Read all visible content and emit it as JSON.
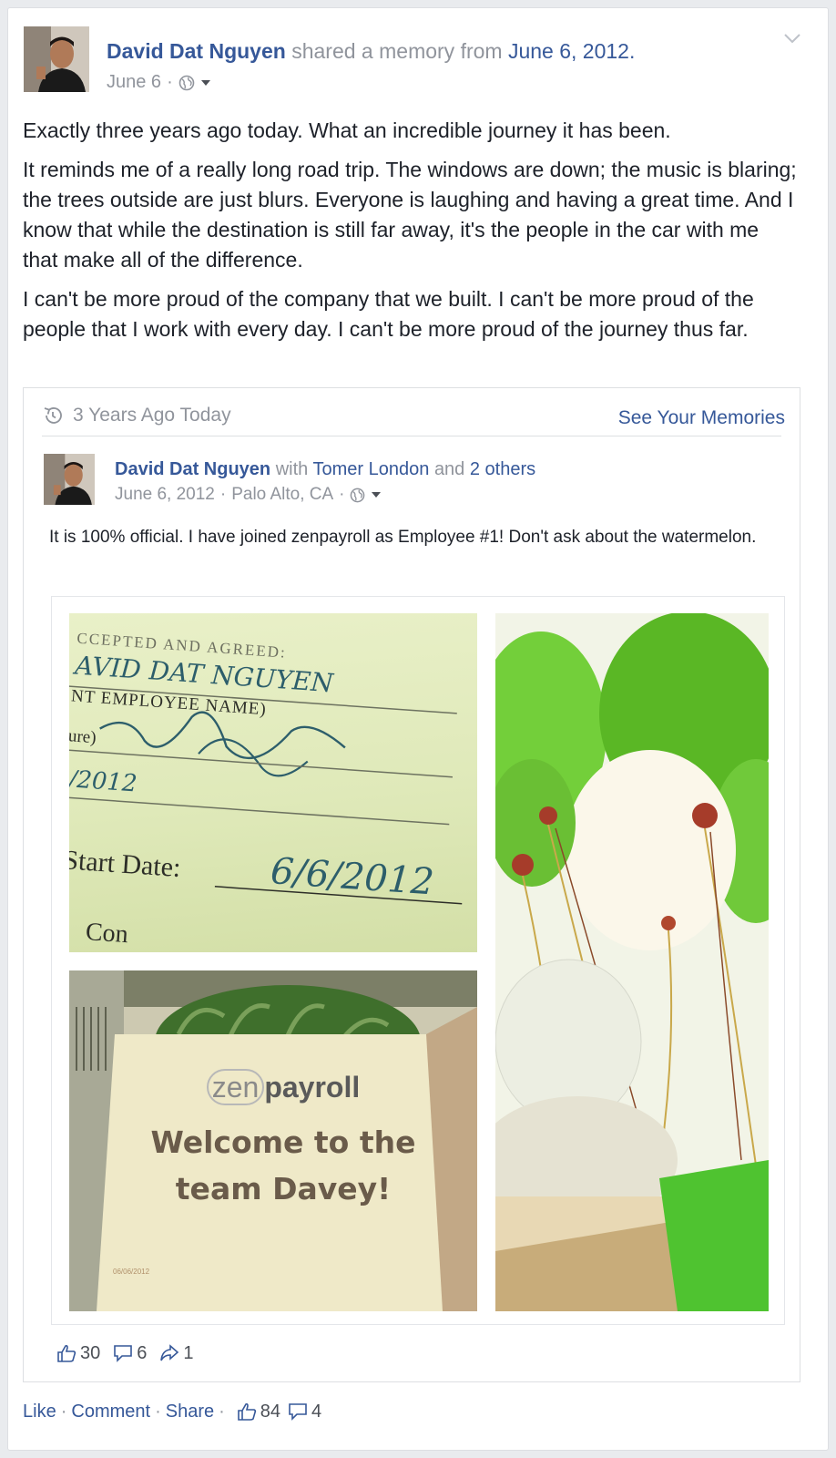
{
  "post": {
    "author": "David Dat Nguyen",
    "shared_text": "shared a memory from",
    "memory_date": "June 6, 2012.",
    "timestamp": "June 6",
    "separator": "·",
    "paragraphs": [
      "Exactly three years ago today. What an incredible journey it has been.",
      "It reminds me of a really long road trip. The windows are down; the music is blaring; the trees outside are just blurs. Everyone is laughing and having a great time. And I know that while the destination is still far away, it's the people in the car with me that make all of the difference.",
      "I can't be more proud of the company that we built. I can't be more proud of the people that I work with every day. I can't be more proud of the journey thus far."
    ]
  },
  "memory": {
    "title": "3 Years Ago Today",
    "link": "See Your Memories",
    "inner_post": {
      "author": "David Dat Nguyen",
      "with_text": "with",
      "tagged": "Tomer London",
      "and_text": "and",
      "others": "2 others",
      "date": "June 6, 2012",
      "location": "Palo Alto, CA",
      "separator": "·",
      "text": "It is 100% official. I have joined zenpayroll as Employee #1! Don't ask about the watermelon."
    },
    "photo1": {
      "line1": "CCEPTED AND AGREED:",
      "signed_name": "AVID DAT NGUYEN",
      "line2": "NT EMPLOYEE NAME)",
      "line3": "ure)",
      "date_partial": "/2012",
      "start_label": "Start Date:",
      "start_date": "6/6/2012",
      "cut_text": "Con"
    },
    "photo2": {
      "logo_zen": "zen",
      "logo_payroll": "payroll",
      "welcome_line1": "Welcome to the",
      "welcome_line2": "team Davey!",
      "small_date": "06/06/2012"
    },
    "stats": {
      "likes": "30",
      "comments": "6",
      "shares": "1"
    }
  },
  "actions": {
    "like": "Like",
    "comment": "Comment",
    "share": "Share",
    "separator": "·",
    "likes_count": "84",
    "comments_count": "4"
  },
  "colors": {
    "link": "#365899",
    "meta": "#90949c",
    "text": "#1d2129",
    "balloon_green": "#58c322"
  }
}
